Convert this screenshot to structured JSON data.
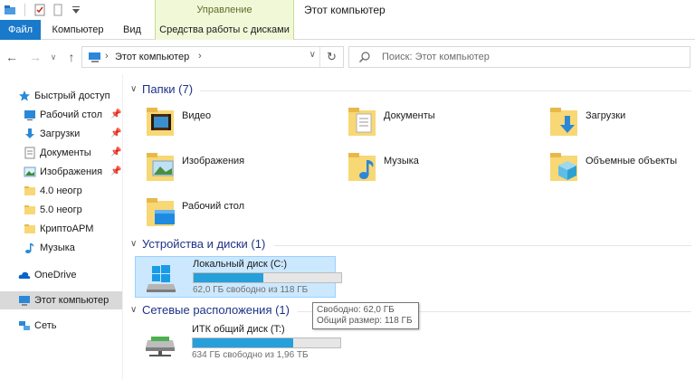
{
  "window": {
    "title": "Этот компьютер",
    "context_group": "Управление"
  },
  "ribbon": {
    "tabs": [
      {
        "label": "Файл"
      },
      {
        "label": "Компьютер"
      },
      {
        "label": "Вид"
      },
      {
        "label": "Средства работы с дисками"
      }
    ]
  },
  "address": {
    "crumb": "Этот компьютер",
    "search_placeholder": "Поиск: Этот компьютер"
  },
  "sidebar": {
    "items": [
      {
        "label": "Быстрый доступ",
        "icon": "star-icon"
      },
      {
        "label": "Рабочий стол",
        "icon": "desktop-folder-icon",
        "pinned": true
      },
      {
        "label": "Загрузки",
        "icon": "download-arrow-icon",
        "pinned": true
      },
      {
        "label": "Документы",
        "icon": "documents-icon",
        "pinned": true
      },
      {
        "label": "Изображения",
        "icon": "pictures-icon",
        "pinned": true
      },
      {
        "label": "4.0 неогр",
        "icon": "folder-icon"
      },
      {
        "label": "5.0 неогр",
        "icon": "folder-icon"
      },
      {
        "label": "КриптоАРМ",
        "icon": "folder-icon"
      },
      {
        "label": "Музыка",
        "icon": "music-note-icon"
      },
      {
        "label": "OneDrive",
        "icon": "cloud-icon"
      },
      {
        "label": "Этот компьютер",
        "icon": "computer-icon",
        "selected": true
      },
      {
        "label": "Сеть",
        "icon": "network-icon"
      }
    ]
  },
  "groups": {
    "folders": {
      "title": "Папки (7)",
      "items": [
        {
          "label": "Видео"
        },
        {
          "label": "Документы"
        },
        {
          "label": "Загрузки"
        },
        {
          "label": "Изображения"
        },
        {
          "label": "Музыка"
        },
        {
          "label": "Объемные объекты"
        },
        {
          "label": "Рабочий стол"
        }
      ]
    },
    "devices": {
      "title": "Устройства и диски (1)",
      "items": [
        {
          "name": "Локальный диск (C:)",
          "free_text": "62,0 ГБ свободно из 118 ГБ",
          "used_fraction": 0.47
        }
      ]
    },
    "network": {
      "title": "Сетевые расположения (1)",
      "items": [
        {
          "name": "ИТК общий диск (T:)",
          "free_text": "634 ГБ свободно из 1,96 ТБ",
          "used_fraction": 0.68
        }
      ]
    }
  },
  "tooltip": {
    "line1": "Свободно: 62,0 ГБ",
    "line2": "Общий размер: 118 ГБ"
  },
  "colors": {
    "accent": "#1979ca",
    "group_title": "#1e3287",
    "selection": "#cce8ff",
    "bar_fill": "#26a0da"
  }
}
